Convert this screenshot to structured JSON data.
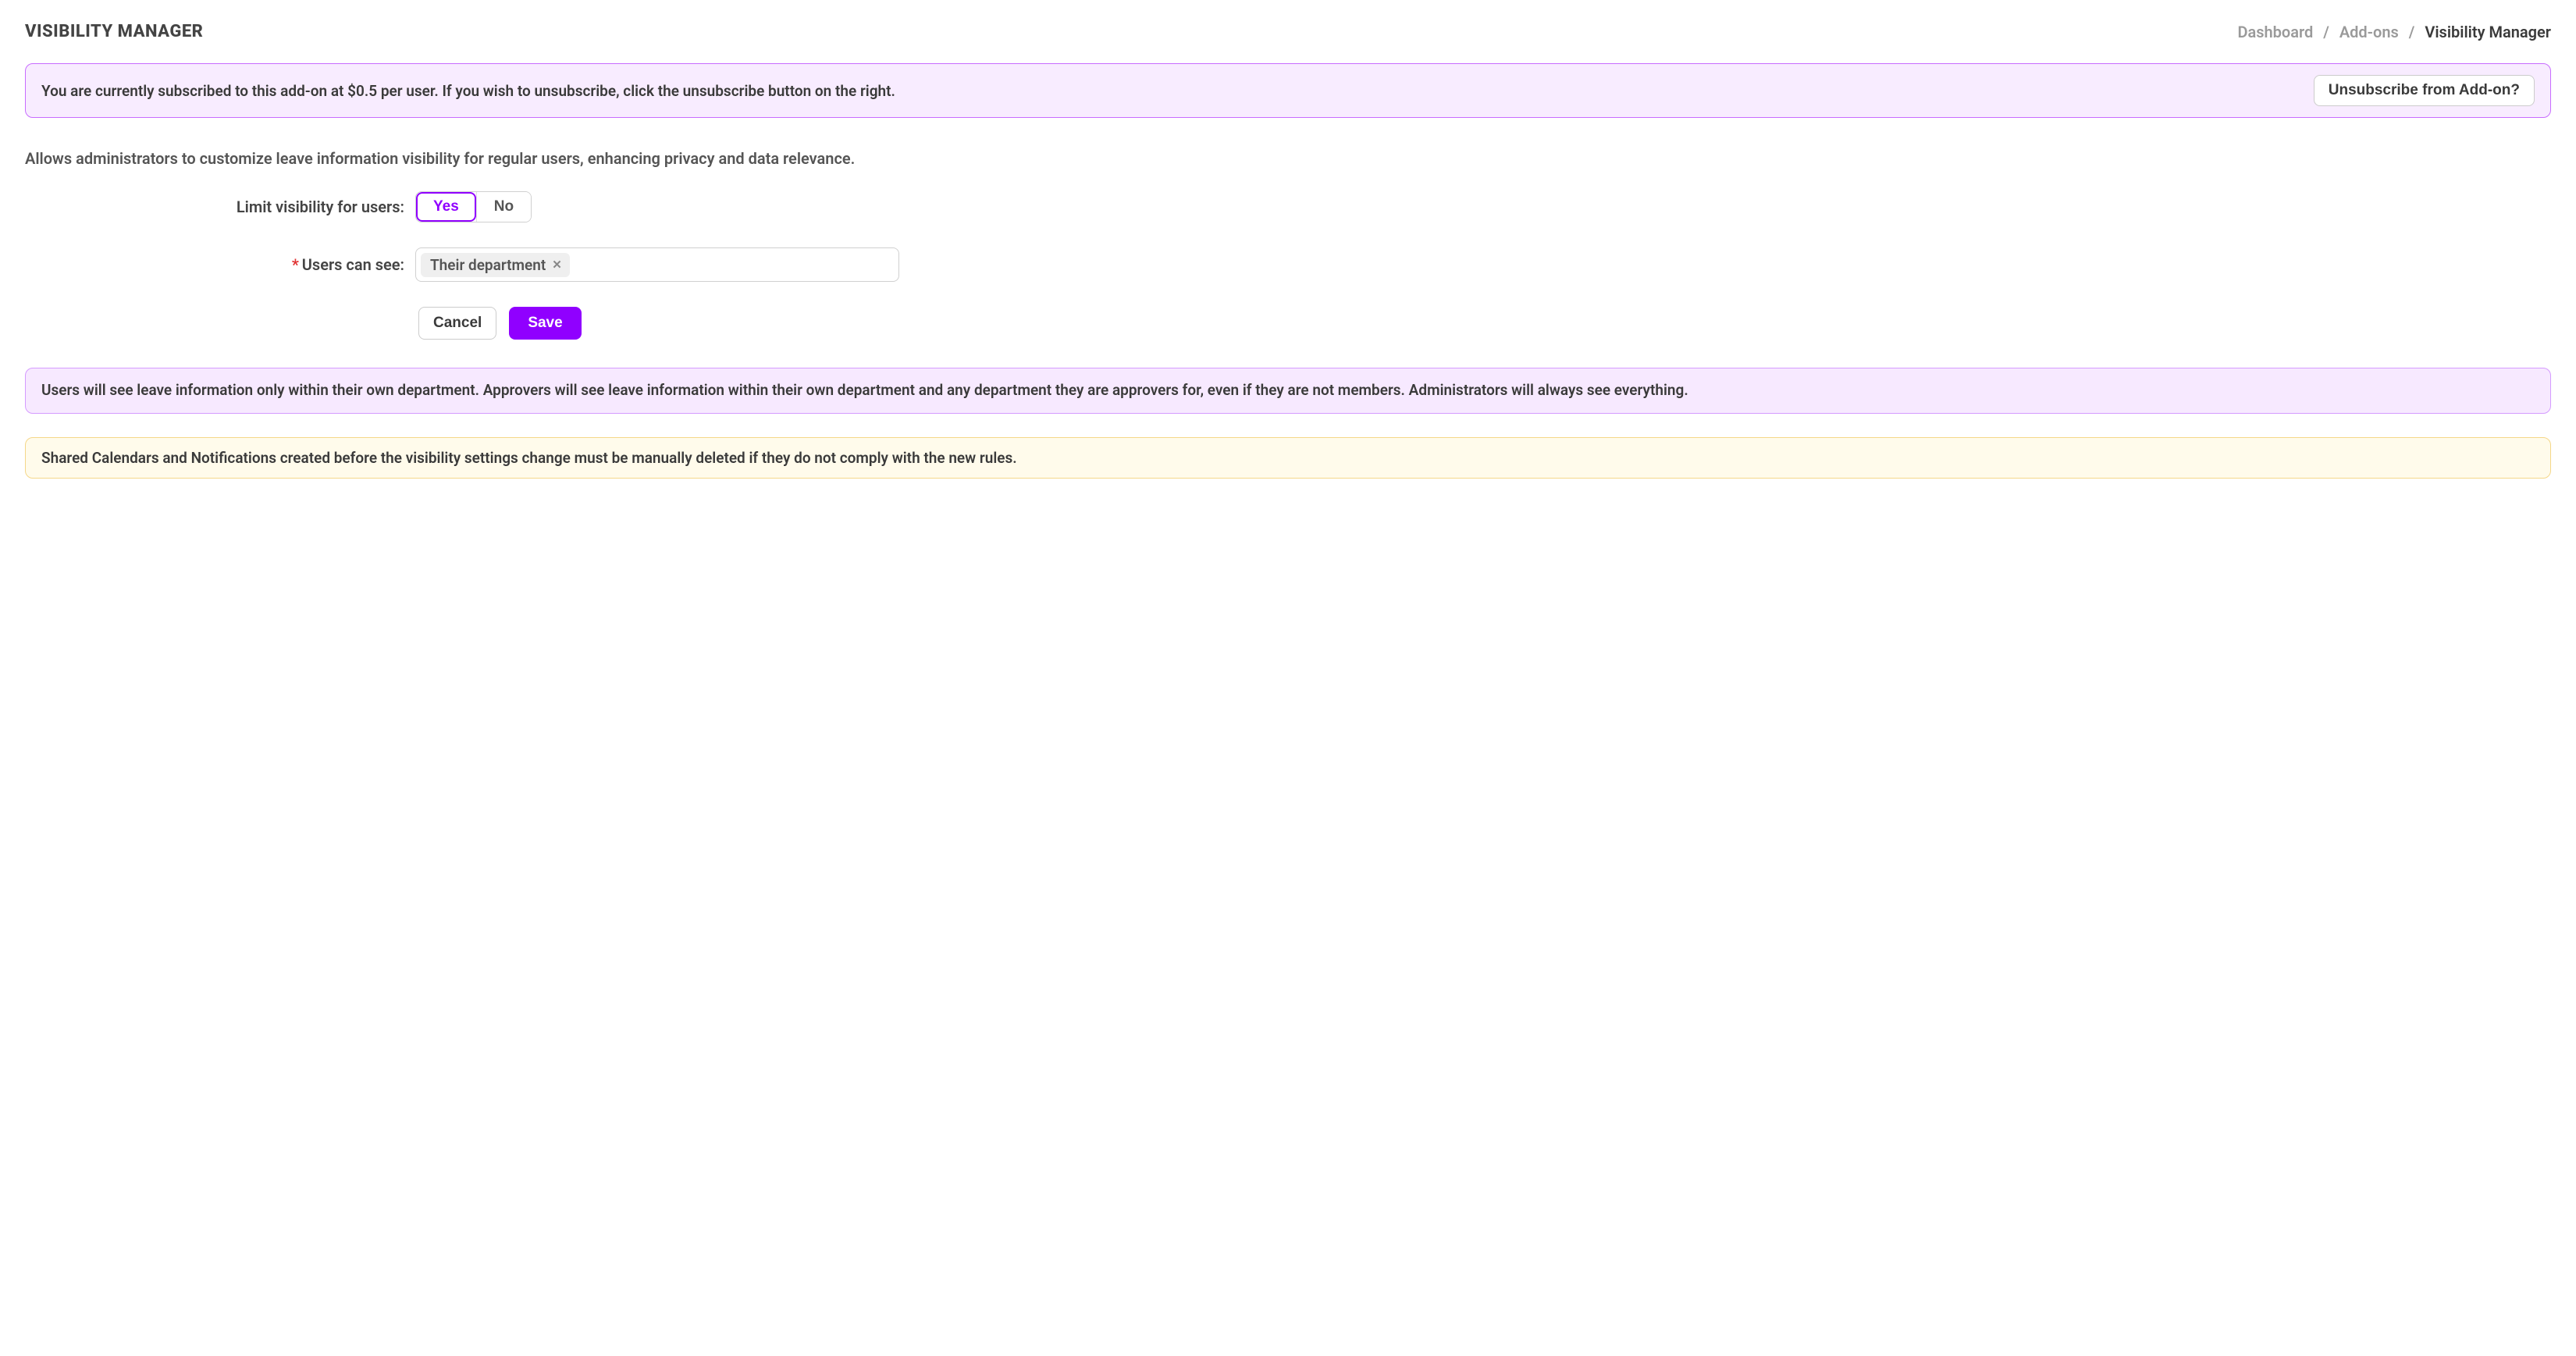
{
  "header": {
    "title": "VISIBILITY MANAGER",
    "breadcrumb": {
      "dashboard": "Dashboard",
      "addons": "Add-ons",
      "current": "Visibility Manager",
      "sep": "/"
    }
  },
  "subscription_banner": {
    "text": "You are currently subscribed to this add-on at $0.5 per user. If you wish to unsubscribe, click the unsubscribe button on the right.",
    "unsubscribe_label": "Unsubscribe from Add-on?"
  },
  "description": "Allows administrators to customize leave information visibility for regular users, enhancing privacy and data relevance.",
  "form": {
    "limit_label": "Limit visibility for users:",
    "option_yes": "Yes",
    "option_no": "No",
    "limit_selected": "Yes",
    "users_see_label": "Users can see:",
    "users_see_required": true,
    "users_see_tags": [
      "Their department"
    ],
    "cancel_label": "Cancel",
    "save_label": "Save"
  },
  "info_purple": "Users will see leave information only within their own department. Approvers will see leave information within their own department and any department they are approvers for, even if they are not members. Administrators will always see everything.",
  "info_yellow": "Shared Calendars and Notifications created before the visibility settings change must be manually deleted if they do not comply with the new rules."
}
